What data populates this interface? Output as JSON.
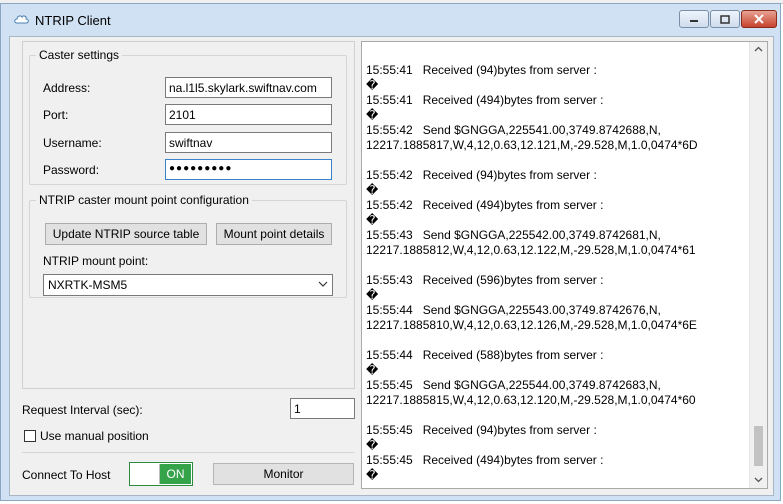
{
  "window": {
    "title": "NTRIP Client"
  },
  "caster": {
    "legend": "Caster settings",
    "address_label": "Address:",
    "address_value": "na.l1l5.skylark.swiftnav.com",
    "port_label": "Port:",
    "port_value": "2101",
    "username_label": "Username:",
    "username_value": "swiftnav",
    "password_label": "Password:",
    "password_value": "●●●●●●●●●"
  },
  "mount": {
    "legend": "NTRIP caster mount point configuration",
    "update_button": "Update NTRIP source table",
    "details_button": "Mount point details",
    "mount_label": "NTRIP mount point:",
    "mount_value": "NXRTK-MSM5"
  },
  "interval": {
    "label": "Request Interval (sec):",
    "value": "1"
  },
  "manual_position": {
    "label": "Use manual position"
  },
  "connect": {
    "label": "Connect To Host",
    "toggle_text": "ON"
  },
  "monitor_button": "Monitor",
  "log_lines": [
    "",
    "15:55:41   Received (94)bytes from server :",
    "�",
    "15:55:41   Received (494)bytes from server :",
    "�",
    "15:55:42   Send $GNGGA,225541.00,3749.8742688,N,",
    "12217.1885817,W,4,12,0.63,12.121,M,-29.528,M,1.0,0474*6D",
    "",
    "15:55:42   Received (94)bytes from server :",
    "�",
    "15:55:42   Received (494)bytes from server :",
    "�",
    "15:55:43   Send $GNGGA,225542.00,3749.8742681,N,",
    "12217.1885812,W,4,12,0.63,12.122,M,-29.528,M,1.0,0474*61",
    "",
    "15:55:43   Received (596)bytes from server :",
    "�",
    "15:55:44   Send $GNGGA,225543.00,3749.8742676,N,",
    "12217.1885810,W,4,12,0.63,12.126,M,-29.528,M,1.0,0474*6E",
    "",
    "15:55:44   Received (588)bytes from server :",
    "�",
    "15:55:45   Send $GNGGA,225544.00,3749.8742683,N,",
    "12217.1885815,W,4,12,0.63,12.120,M,-29.528,M,1.0,0474*60",
    "",
    "15:55:45   Received (94)bytes from server :",
    "�",
    "15:55:45   Received (494)bytes from server :",
    "�"
  ],
  "icons": {
    "app": "cloud-icon",
    "minimize": "minimize-icon",
    "maximize": "maximize-icon",
    "close": "close-icon",
    "dropdown": "chevron-down-icon",
    "scroll_up": "chevron-up-icon",
    "scroll_down": "chevron-down-icon"
  },
  "colors": {
    "toggle_on": "#35a34a",
    "close_button": "#c7432d",
    "focus_border": "#3a82c9"
  }
}
